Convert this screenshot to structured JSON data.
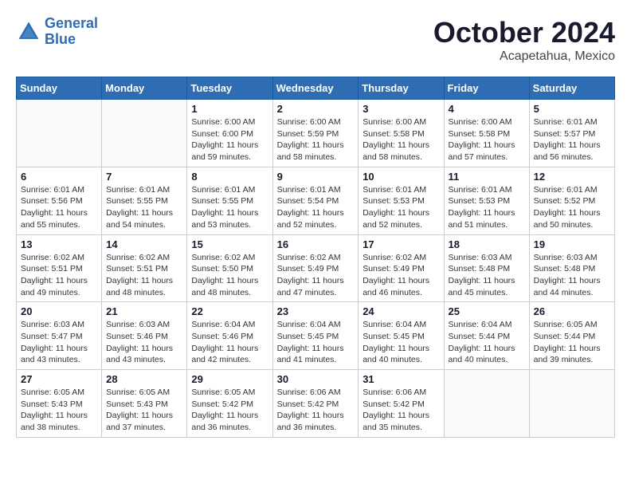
{
  "header": {
    "logo_line1": "General",
    "logo_line2": "Blue",
    "month": "October 2024",
    "location": "Acapetahua, Mexico"
  },
  "weekdays": [
    "Sunday",
    "Monday",
    "Tuesday",
    "Wednesday",
    "Thursday",
    "Friday",
    "Saturday"
  ],
  "weeks": [
    [
      {
        "day": "",
        "info": ""
      },
      {
        "day": "",
        "info": ""
      },
      {
        "day": "1",
        "info": "Sunrise: 6:00 AM\nSunset: 6:00 PM\nDaylight: 11 hours and 59 minutes."
      },
      {
        "day": "2",
        "info": "Sunrise: 6:00 AM\nSunset: 5:59 PM\nDaylight: 11 hours and 58 minutes."
      },
      {
        "day": "3",
        "info": "Sunrise: 6:00 AM\nSunset: 5:58 PM\nDaylight: 11 hours and 58 minutes."
      },
      {
        "day": "4",
        "info": "Sunrise: 6:00 AM\nSunset: 5:58 PM\nDaylight: 11 hours and 57 minutes."
      },
      {
        "day": "5",
        "info": "Sunrise: 6:01 AM\nSunset: 5:57 PM\nDaylight: 11 hours and 56 minutes."
      }
    ],
    [
      {
        "day": "6",
        "info": "Sunrise: 6:01 AM\nSunset: 5:56 PM\nDaylight: 11 hours and 55 minutes."
      },
      {
        "day": "7",
        "info": "Sunrise: 6:01 AM\nSunset: 5:55 PM\nDaylight: 11 hours and 54 minutes."
      },
      {
        "day": "8",
        "info": "Sunrise: 6:01 AM\nSunset: 5:55 PM\nDaylight: 11 hours and 53 minutes."
      },
      {
        "day": "9",
        "info": "Sunrise: 6:01 AM\nSunset: 5:54 PM\nDaylight: 11 hours and 52 minutes."
      },
      {
        "day": "10",
        "info": "Sunrise: 6:01 AM\nSunset: 5:53 PM\nDaylight: 11 hours and 52 minutes."
      },
      {
        "day": "11",
        "info": "Sunrise: 6:01 AM\nSunset: 5:53 PM\nDaylight: 11 hours and 51 minutes."
      },
      {
        "day": "12",
        "info": "Sunrise: 6:01 AM\nSunset: 5:52 PM\nDaylight: 11 hours and 50 minutes."
      }
    ],
    [
      {
        "day": "13",
        "info": "Sunrise: 6:02 AM\nSunset: 5:51 PM\nDaylight: 11 hours and 49 minutes."
      },
      {
        "day": "14",
        "info": "Sunrise: 6:02 AM\nSunset: 5:51 PM\nDaylight: 11 hours and 48 minutes."
      },
      {
        "day": "15",
        "info": "Sunrise: 6:02 AM\nSunset: 5:50 PM\nDaylight: 11 hours and 48 minutes."
      },
      {
        "day": "16",
        "info": "Sunrise: 6:02 AM\nSunset: 5:49 PM\nDaylight: 11 hours and 47 minutes."
      },
      {
        "day": "17",
        "info": "Sunrise: 6:02 AM\nSunset: 5:49 PM\nDaylight: 11 hours and 46 minutes."
      },
      {
        "day": "18",
        "info": "Sunrise: 6:03 AM\nSunset: 5:48 PM\nDaylight: 11 hours and 45 minutes."
      },
      {
        "day": "19",
        "info": "Sunrise: 6:03 AM\nSunset: 5:48 PM\nDaylight: 11 hours and 44 minutes."
      }
    ],
    [
      {
        "day": "20",
        "info": "Sunrise: 6:03 AM\nSunset: 5:47 PM\nDaylight: 11 hours and 43 minutes."
      },
      {
        "day": "21",
        "info": "Sunrise: 6:03 AM\nSunset: 5:46 PM\nDaylight: 11 hours and 43 minutes."
      },
      {
        "day": "22",
        "info": "Sunrise: 6:04 AM\nSunset: 5:46 PM\nDaylight: 11 hours and 42 minutes."
      },
      {
        "day": "23",
        "info": "Sunrise: 6:04 AM\nSunset: 5:45 PM\nDaylight: 11 hours and 41 minutes."
      },
      {
        "day": "24",
        "info": "Sunrise: 6:04 AM\nSunset: 5:45 PM\nDaylight: 11 hours and 40 minutes."
      },
      {
        "day": "25",
        "info": "Sunrise: 6:04 AM\nSunset: 5:44 PM\nDaylight: 11 hours and 40 minutes."
      },
      {
        "day": "26",
        "info": "Sunrise: 6:05 AM\nSunset: 5:44 PM\nDaylight: 11 hours and 39 minutes."
      }
    ],
    [
      {
        "day": "27",
        "info": "Sunrise: 6:05 AM\nSunset: 5:43 PM\nDaylight: 11 hours and 38 minutes."
      },
      {
        "day": "28",
        "info": "Sunrise: 6:05 AM\nSunset: 5:43 PM\nDaylight: 11 hours and 37 minutes."
      },
      {
        "day": "29",
        "info": "Sunrise: 6:05 AM\nSunset: 5:42 PM\nDaylight: 11 hours and 36 minutes."
      },
      {
        "day": "30",
        "info": "Sunrise: 6:06 AM\nSunset: 5:42 PM\nDaylight: 11 hours and 36 minutes."
      },
      {
        "day": "31",
        "info": "Sunrise: 6:06 AM\nSunset: 5:42 PM\nDaylight: 11 hours and 35 minutes."
      },
      {
        "day": "",
        "info": ""
      },
      {
        "day": "",
        "info": ""
      }
    ]
  ]
}
